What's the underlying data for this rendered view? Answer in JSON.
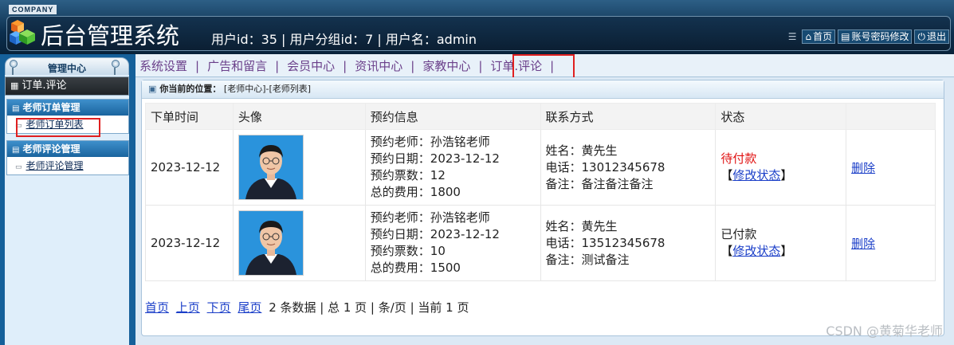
{
  "header": {
    "company": "COMPANY",
    "title": "后台管理系统",
    "user_info": "用户id：35 | 用户分组id：7 | 用户名：admin",
    "links": [
      {
        "label": "首页",
        "icon": "home-icon"
      },
      {
        "label": "账号密码修改",
        "icon": "list-icon"
      },
      {
        "label": "退出",
        "icon": "power-icon"
      }
    ]
  },
  "sidebar": {
    "title": "管理中心",
    "current": "订单.评论",
    "groups": [
      {
        "title": "老师订单管理",
        "items": [
          "老师订单列表"
        ]
      },
      {
        "title": "老师评论管理",
        "items": [
          "老师评论管理"
        ]
      }
    ]
  },
  "topnav": {
    "tabs": [
      "系统设置",
      "广告和留言",
      "会员中心",
      "资讯中心",
      "家教中心",
      "订单.评论"
    ],
    "separator": "|"
  },
  "breadcrumb": {
    "label": "你当前的位置：",
    "path": "[老师中心]-[老师列表]"
  },
  "table": {
    "headers": [
      "下单时间",
      "头像",
      "预约信息",
      "联系方式",
      "状态",
      ""
    ],
    "rows": [
      {
        "time": "2023-12-12",
        "booking": [
          "预约老师：孙浩铭老师",
          "预约日期：2023-12-12",
          "预约票数：12",
          "总的费用：1800"
        ],
        "contact": [
          "姓名：黄先生",
          "电话：13012345678",
          "备注：备注备注备注"
        ],
        "status": "待付款",
        "status_color": "#e01010",
        "modify": "修改状态",
        "delete": "删除"
      },
      {
        "time": "2023-12-12",
        "booking": [
          "预约老师：孙浩铭老师",
          "预约日期：2023-12-12",
          "预约票数：10",
          "总的费用：1500"
        ],
        "contact": [
          "姓名：黄先生",
          "电话：13512345678",
          "备注：测试备注"
        ],
        "status": "已付款",
        "status_color": "#222222",
        "modify": "修改状态",
        "delete": "删除"
      }
    ]
  },
  "pager": {
    "links": [
      "首页",
      "上页",
      "下页",
      "尾页"
    ],
    "summary": "2 条数据 | 总 1 页 | 条/页 | 当前 1 页"
  },
  "watermark": "CSDN @黄菊华老师"
}
